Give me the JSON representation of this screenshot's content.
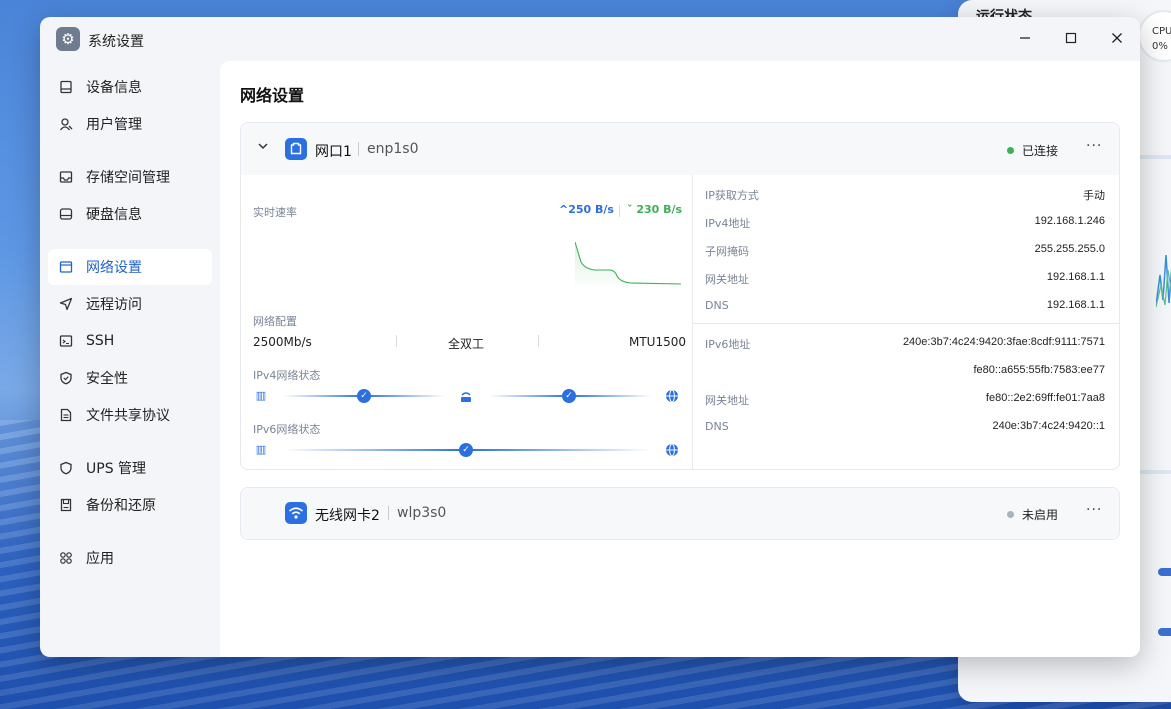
{
  "background_widget": {
    "title": "运行状态",
    "cpu_label": "CPU",
    "cpu_value": "0%"
  },
  "window": {
    "title": "系统设置",
    "minimize_icon": "minimize-icon",
    "maximize_icon": "maximize-icon",
    "close_icon": "close-icon"
  },
  "sidebar": {
    "items": [
      {
        "label": "设备信息",
        "icon": "device-icon"
      },
      {
        "label": "用户管理",
        "icon": "user-icon"
      },
      {
        "label": "存储空间管理",
        "icon": "storage-icon"
      },
      {
        "label": "硬盘信息",
        "icon": "disk-icon"
      },
      {
        "label": "网络设置",
        "icon": "network-icon",
        "active": true
      },
      {
        "label": "远程访问",
        "icon": "send-icon"
      },
      {
        "label": "SSH",
        "icon": "ssh-icon"
      },
      {
        "label": "安全性",
        "icon": "shield-icon"
      },
      {
        "label": "文件共享协议",
        "icon": "file-icon"
      },
      {
        "label": "UPS 管理",
        "icon": "ups-icon"
      },
      {
        "label": "备份和还原",
        "icon": "backup-icon"
      },
      {
        "label": "应用",
        "icon": "apps-icon"
      }
    ]
  },
  "main": {
    "title": "网络设置",
    "port1": {
      "name": "网口1",
      "device": "enp1s0",
      "status": "已连接",
      "status_color": "#3fae58",
      "speed_label": "实时速率",
      "upload": "250 B/s",
      "download": "230 B/s",
      "config_label": "网络配置",
      "link_speed": "2500Mb/s",
      "duplex": "全双工",
      "mtu": "MTU1500",
      "ipv4_state_label": "IPv4网络状态",
      "ipv6_state_label": "IPv6网络状态",
      "ipv4": [
        {
          "key": "IP获取方式",
          "value": "手动"
        },
        {
          "key": "IPv4地址",
          "value": "192.168.1.246"
        },
        {
          "key": "子网掩码",
          "value": "255.255.255.0"
        },
        {
          "key": "网关地址",
          "value": "192.168.1.1"
        },
        {
          "key": "DNS",
          "value": "192.168.1.1"
        }
      ],
      "ipv6": [
        {
          "key": "IPv6地址",
          "value": "240e:3b7:4c24:9420:3fae:8cdf:9111:7571"
        },
        {
          "key": "",
          "value": "fe80::a655:55fb:7583:ee77"
        },
        {
          "key": "网关地址",
          "value": "fe80::2e2:69ff:fe01:7aa8"
        },
        {
          "key": "DNS",
          "value": "240e:3b7:4c24:9420::1"
        }
      ]
    },
    "wifi": {
      "name": "无线网卡2",
      "device": "wlp3s0",
      "status": "未启用",
      "status_color": "#a8b2c2"
    }
  }
}
